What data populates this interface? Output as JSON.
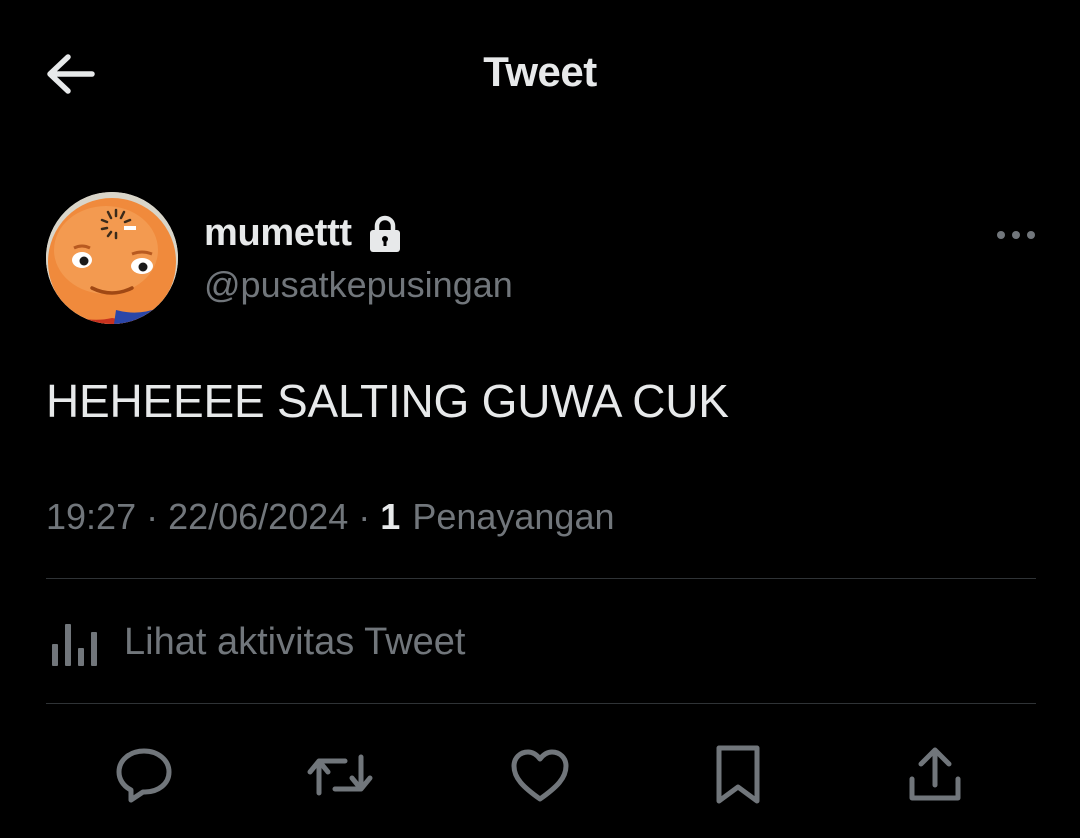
{
  "header": {
    "title": "Tweet",
    "back_icon": "arrow-left-icon"
  },
  "author": {
    "display_name": "mumettt",
    "handle": "@pusatkepusingan",
    "protected_icon": "lock-icon",
    "avatar_description": "cartoon-boy-face",
    "more_icon": "more-horizontal-icon"
  },
  "tweet": {
    "text": "HEHEEEE SALTING GUWA CUK",
    "time": "19:27",
    "date": "22/06/2024",
    "separator": "·",
    "view_count": "1",
    "view_label": "Penayangan"
  },
  "activity": {
    "label": "Lihat aktivitas Tweet",
    "icon": "analytics-bars-icon"
  },
  "actions": [
    {
      "name": "reply",
      "icon": "reply-bubble-icon"
    },
    {
      "name": "retweet",
      "icon": "retweet-icon"
    },
    {
      "name": "like",
      "icon": "heart-icon"
    },
    {
      "name": "bookmark",
      "icon": "bookmark-icon"
    },
    {
      "name": "share",
      "icon": "share-upload-icon"
    }
  ],
  "colors": {
    "background": "#000000",
    "primary_text": "#e7e9ea",
    "secondary_text": "#71767b",
    "divider": "#2f3336"
  }
}
